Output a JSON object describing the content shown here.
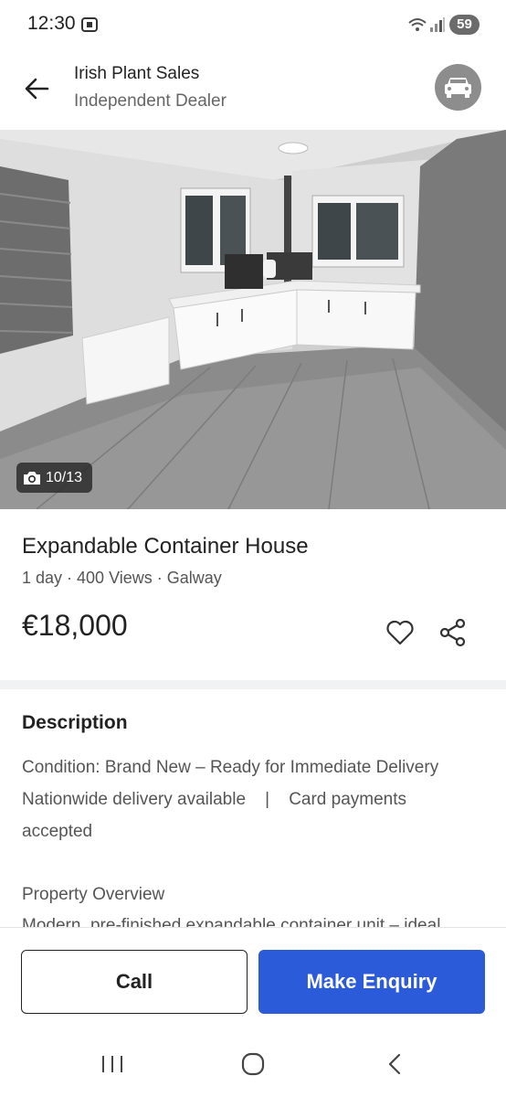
{
  "status_bar": {
    "time": "12:30",
    "battery": "59",
    "icons": [
      "screenshot-icon",
      "wifi-icon",
      "signal-icon"
    ]
  },
  "header": {
    "seller_name": "Irish Plant Sales",
    "seller_type": "Independent Dealer",
    "avatar_icon": "car-icon"
  },
  "gallery": {
    "counter": "10/13",
    "counter_icon": "camera-icon"
  },
  "listing": {
    "title": "Expandable Container House",
    "meta": "1 day · 400 Views · Galway",
    "price": "€18,000"
  },
  "description": {
    "heading": "Description",
    "lines": [
      "Condition: Brand New – Ready for Immediate Delivery",
      "Nationwide delivery available    |    Card payments",
      "accepted",
      "Property Overview",
      "Modern, pre-finished expandable container unit – ideal"
    ]
  },
  "actions": {
    "call_label": "Call",
    "enquiry_label": "Make Enquiry"
  },
  "colors": {
    "primary": "#2b5bd9",
    "text": "#222222",
    "muted": "#555555"
  }
}
